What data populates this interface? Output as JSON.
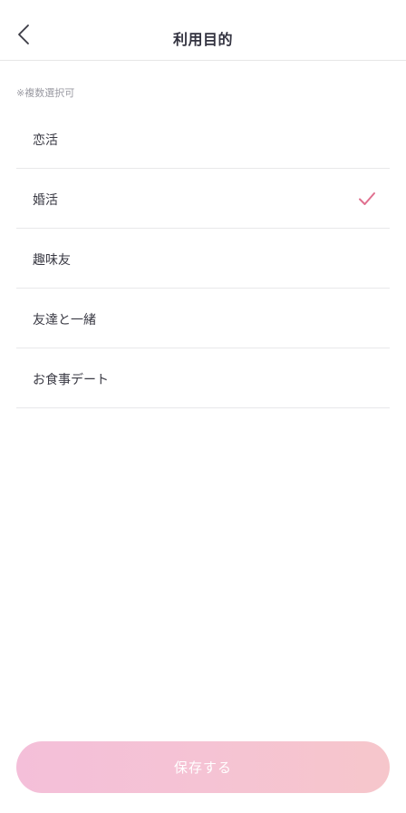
{
  "header": {
    "back_icon": "chevron-left-icon",
    "title": "利用目的"
  },
  "note": "※複数選択可",
  "options": [
    {
      "label": "恋活",
      "selected": false
    },
    {
      "label": "婚活",
      "selected": true
    },
    {
      "label": "趣味友",
      "selected": false
    },
    {
      "label": "友達と一緒",
      "selected": false
    },
    {
      "label": "お食事デート",
      "selected": false
    }
  ],
  "check_icon": "checkmark-icon",
  "colors": {
    "accent": "#e0708f",
    "save_gradient_start": "#f4bfd9",
    "save_gradient_end": "#f6c6cb",
    "divider": "#e8e8ea"
  },
  "save_button": {
    "label": "保存する"
  }
}
